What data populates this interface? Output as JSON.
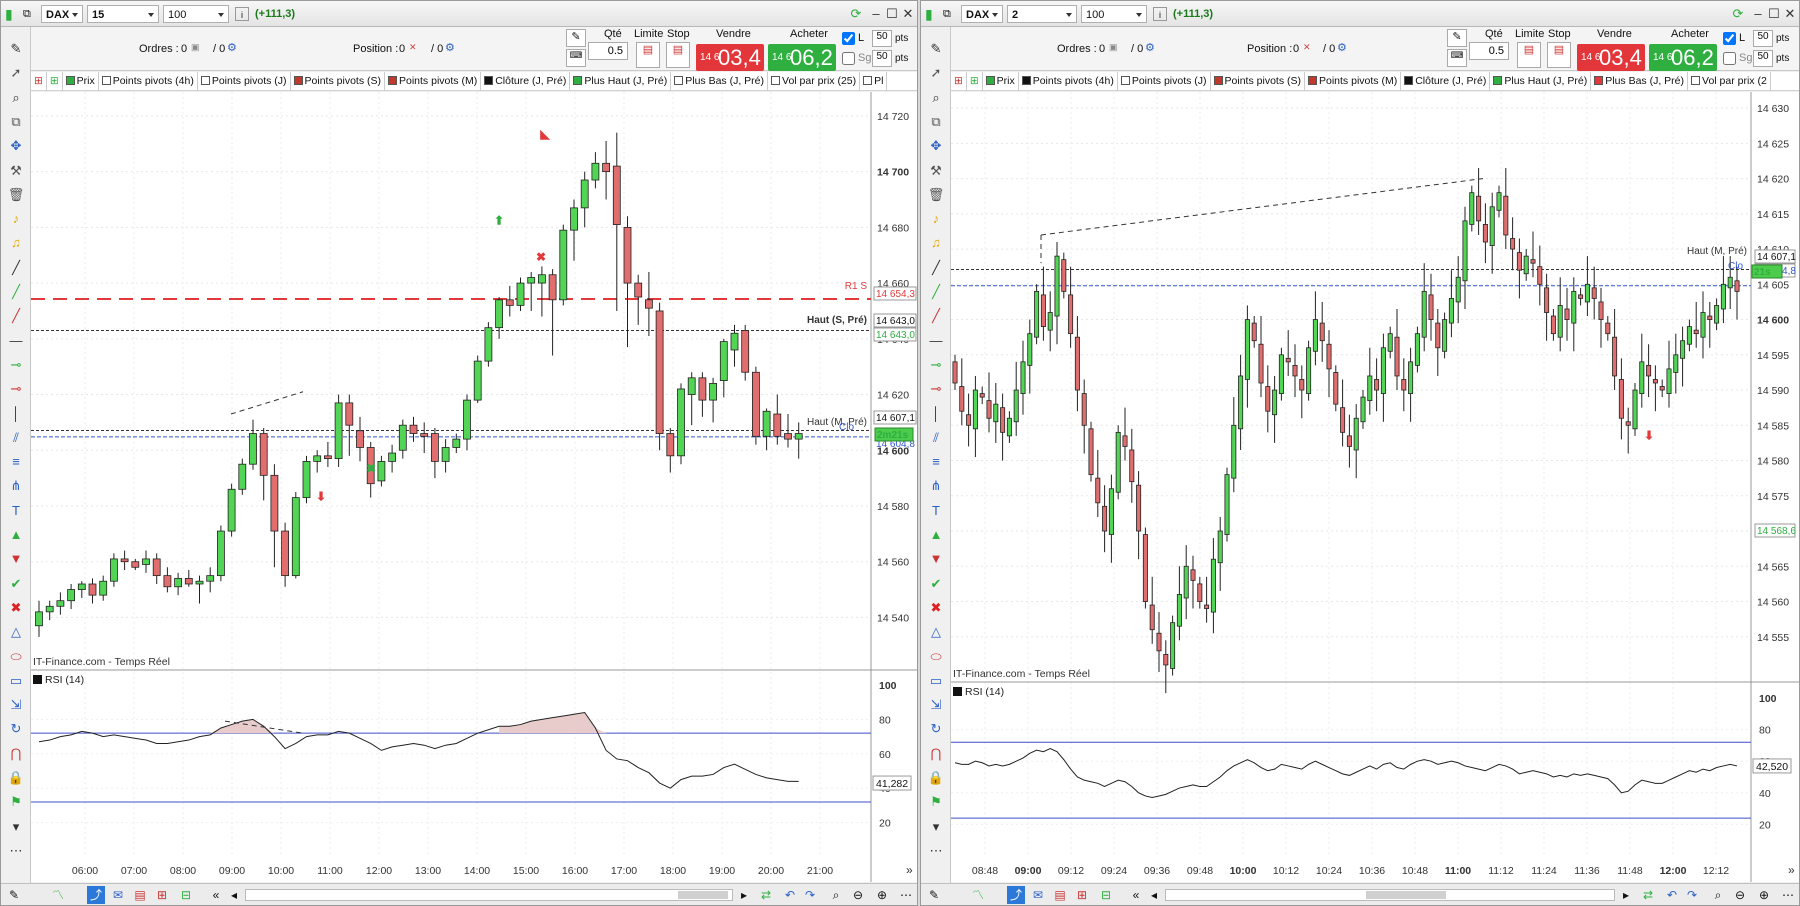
{
  "windows": [
    {
      "instrument": "DAX",
      "timeframe": "15 minutes",
      "units": "100 unités",
      "change": "(+111,3)",
      "orders_label": "Ordres :",
      "orders_value": "0",
      "orders_value2": "/ 0",
      "position_label": "Position :",
      "position_value": "0",
      "position_value2": "/ 0",
      "qty_label": "Qté",
      "qty_value": "0.5",
      "limit_label": "Limite",
      "stop_label": "Stop",
      "sell_label": "Vendre",
      "buy_label": "Acheter",
      "sell_small": "14 6",
      "sell_big": "03,4",
      "buy_small": "14 6",
      "buy_big": "06,2",
      "l_label": "L",
      "sg_label": "Sg",
      "pts1": "50",
      "pts2": "50",
      "pts_label": "pts",
      "indicators": [
        {
          "label": "Prix",
          "color": "#2eaf3f"
        },
        {
          "label": "Points pivots (4h)",
          "color": "#ffffff"
        },
        {
          "label": "Points pivots (J)",
          "color": "#ffffff"
        },
        {
          "label": "Points pivots (S)",
          "color": "#c0392b"
        },
        {
          "label": "Points pivots (M)",
          "color": "#c0392b"
        },
        {
          "label": "Clôture (J, Pré)",
          "color": "#111111"
        },
        {
          "label": "Plus Haut (J, Pré)",
          "color": "#2eaf3f"
        },
        {
          "label": "Plus Bas (J, Pré)",
          "color": "#ffffff"
        },
        {
          "label": "Vol par prix (25)",
          "color": "#ffffff"
        },
        {
          "label": "Pl",
          "color": "#ffffff"
        }
      ],
      "source": "IT-Finance.com - Temps Réel",
      "rsi_label": "RSI (14)",
      "rsi_value": "41,282",
      "price_labels": [
        "14 720",
        "14 700",
        "14 680",
        "14 660",
        "14 640",
        "14 620",
        "14 600",
        "14 580",
        "14 560",
        "14 540"
      ],
      "rsi_levels": [
        "100",
        "80",
        "60",
        "40",
        "20"
      ],
      "time_labels": [
        "06:00",
        "07:00",
        "08:00",
        "09:00",
        "10:00",
        "11:00",
        "12:00",
        "13:00",
        "14:00",
        "15:00",
        "16:00",
        "17:00",
        "18:00",
        "19:00",
        "20:00",
        "21:00"
      ],
      "level_labels": [
        {
          "text": "R1 S",
          "color": "#e23a3a"
        },
        {
          "text": "14 654,3",
          "color": "#e23a3a"
        },
        {
          "text": "Haut (S, Pré)",
          "color": "#333333"
        },
        {
          "text": "14 643,0",
          "color": "#111111"
        },
        {
          "text": "14 643,0",
          "color": "#2eaf3f"
        },
        {
          "text": "Haut (M, Pré)",
          "color": "#333333"
        },
        {
          "text": "14 607,1",
          "color": "#111111"
        },
        {
          "text": "14 604,8",
          "color": "#3355cc"
        },
        {
          "text": "2m21s",
          "color": "#2eaf3f"
        },
        {
          "text": "Clo",
          "color": "#3355cc"
        }
      ]
    },
    {
      "instrument": "DAX",
      "timeframe": "2 minutes",
      "units": "100 unités",
      "change": "(+111,3)",
      "orders_label": "Ordres :",
      "orders_value": "0",
      "orders_value2": "/ 0",
      "position_label": "Position :",
      "position_value": "0",
      "position_value2": "/ 0",
      "qty_label": "Qté",
      "qty_value": "0.5",
      "limit_label": "Limite",
      "stop_label": "Stop",
      "sell_label": "Vendre",
      "buy_label": "Acheter",
      "sell_small": "14 6",
      "sell_big": "03,4",
      "buy_small": "14 6",
      "buy_big": "06,2",
      "l_label": "L",
      "sg_label": "Sg",
      "pts1": "50",
      "pts2": "50",
      "pts_label": "pts",
      "indicators": [
        {
          "label": "Prix",
          "color": "#2eaf3f"
        },
        {
          "label": "Points pivots (4h)",
          "color": "#111111"
        },
        {
          "label": "Points pivots (J)",
          "color": "#ffffff"
        },
        {
          "label": "Points pivots (S)",
          "color": "#c0392b"
        },
        {
          "label": "Points pivots (M)",
          "color": "#c0392b"
        },
        {
          "label": "Clôture (J, Pré)",
          "color": "#111111"
        },
        {
          "label": "Plus Haut (J, Pré)",
          "color": "#2eaf3f"
        },
        {
          "label": "Plus Bas (J, Pré)",
          "color": "#e23a3a"
        },
        {
          "label": "Vol par prix (2",
          "color": "#ffffff"
        }
      ],
      "source": "IT-Finance.com - Temps Réel",
      "rsi_label": "RSI (14)",
      "rsi_value": "42,520",
      "price_labels": [
        "14 630",
        "14 625",
        "14 620",
        "14 615",
        "14 610",
        "14 605",
        "14 600",
        "14 595",
        "14 590",
        "14 585",
        "14 580",
        "14 575",
        "14 570",
        "14 565",
        "14 560",
        "14 555"
      ],
      "rsi_levels": [
        "100",
        "80",
        "60",
        "40",
        "20"
      ],
      "time_labels": [
        "08:48",
        "09:00",
        "09:12",
        "09:24",
        "09:36",
        "09:48",
        "10:00",
        "10:12",
        "10:24",
        "10:36",
        "10:48",
        "11:00",
        "11:12",
        "11:24",
        "11:36",
        "11:48",
        "12:00",
        "12:12"
      ],
      "level_labels": [
        {
          "text": "Haut (M, Pré)",
          "color": "#333333"
        },
        {
          "text": "14 607,1",
          "color": "#111111"
        },
        {
          "text": "14 604,8",
          "color": "#3355cc"
        },
        {
          "text": "Clo",
          "color": "#3355cc"
        },
        {
          "text": "21s",
          "color": "#2eaf3f"
        },
        {
          "text": "14 568,6",
          "color": "#2eaf3f"
        }
      ]
    }
  ]
}
